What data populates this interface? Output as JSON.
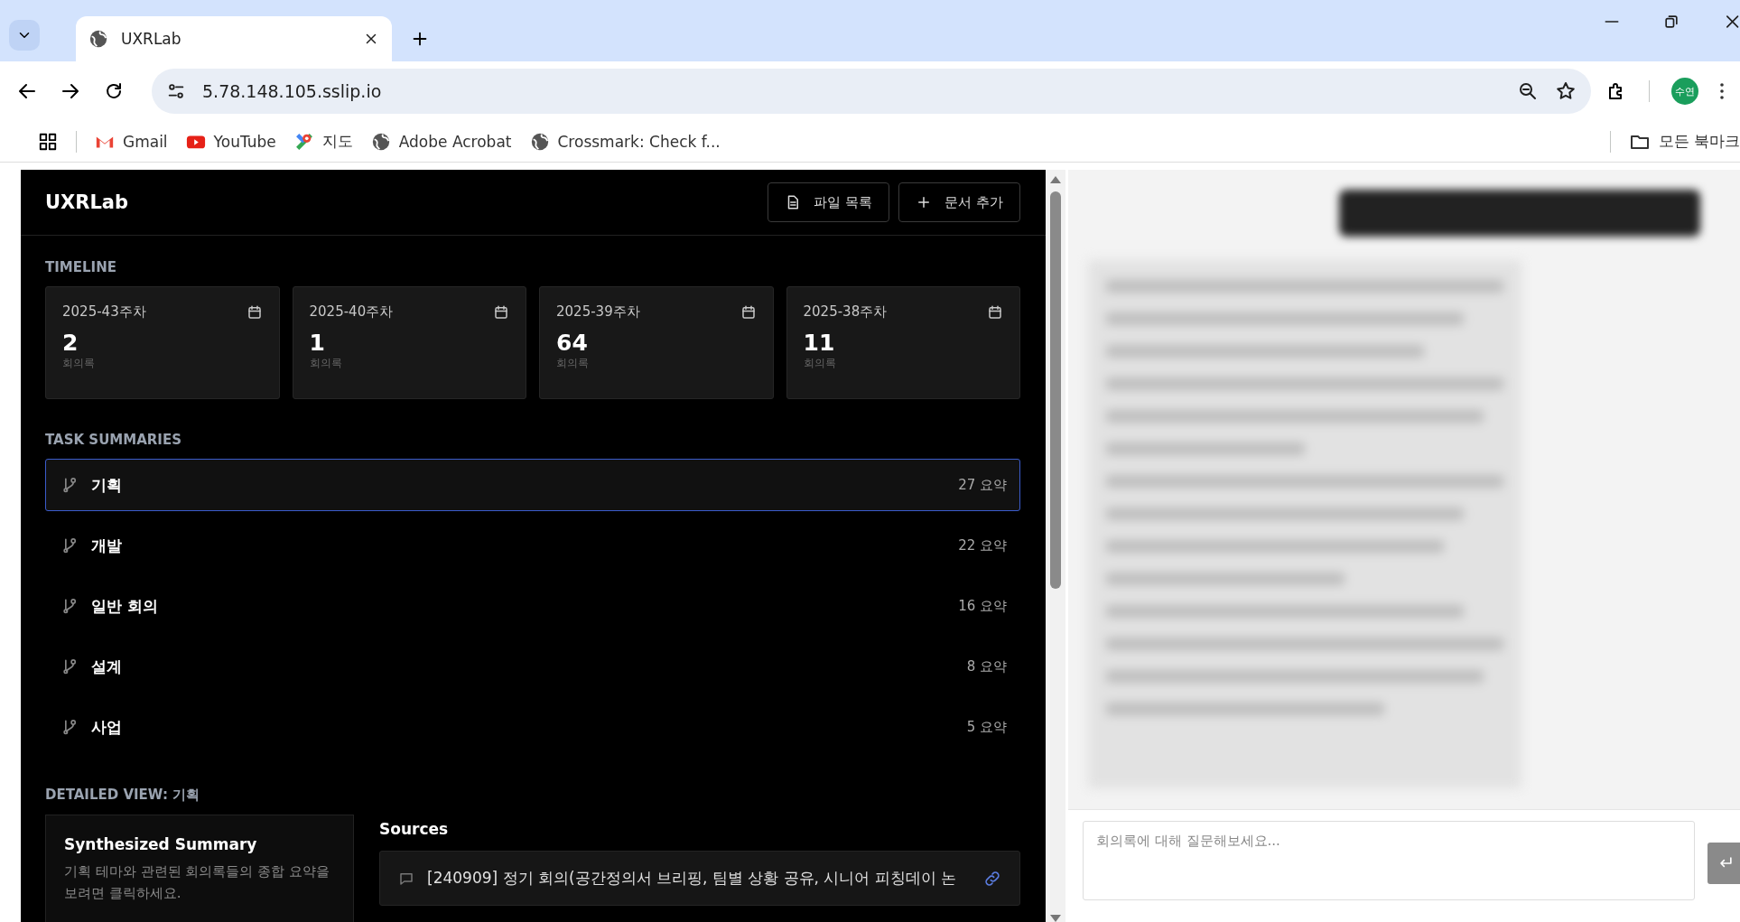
{
  "browser": {
    "tab_title": "UXRLab",
    "url": "5.78.148.105.sslip.io",
    "avatar_text": "수연",
    "bookmarks": [
      {
        "kind": "gmail",
        "label": "Gmail"
      },
      {
        "kind": "youtube",
        "label": "YouTube"
      },
      {
        "kind": "maps",
        "label": "지도"
      },
      {
        "kind": "globe",
        "label": "Adobe Acrobat"
      },
      {
        "kind": "globe",
        "label": "Crossmark: Check f..."
      }
    ],
    "all_bookmarks": "모든 북마크"
  },
  "app": {
    "title": "UXRLab",
    "buttons": [
      {
        "kind": "file",
        "label": "파일 목록"
      },
      {
        "kind": "add",
        "label": "문서 추가"
      }
    ],
    "timeline": {
      "label": "TIMELINE",
      "cards": [
        {
          "week": "2025-43주차",
          "count": "2",
          "unit": "회의록"
        },
        {
          "week": "2025-40주차",
          "count": "1",
          "unit": "회의록"
        },
        {
          "week": "2025-39주차",
          "count": "64",
          "unit": "회의록"
        },
        {
          "week": "2025-38주차",
          "count": "11",
          "unit": "회의록"
        }
      ]
    },
    "tasks": {
      "label": "TASK SUMMARIES",
      "items": [
        {
          "name": "기획",
          "count": "27 요약",
          "selected": true
        },
        {
          "name": "개발",
          "count": "22 요약",
          "selected": false
        },
        {
          "name": "일반 회의",
          "count": "16 요약",
          "selected": false
        },
        {
          "name": "설계",
          "count": "8 요약",
          "selected": false
        },
        {
          "name": "사업",
          "count": "5 요약",
          "selected": false
        }
      ]
    },
    "detail": {
      "label": "DETAILED VIEW: 기획",
      "summary": {
        "title": "Synthesized Summary",
        "text": "기획 테마와 관련된 회의록들의 종합 요약을 보려면 클릭하세요."
      },
      "sources": {
        "label": "Sources",
        "items": [
          {
            "text": "[240909] 정기 회의(공간정의서 브리핑, 팀별 상황 공유, 시니어 피칭데이 논"
          }
        ]
      }
    }
  },
  "chat": {
    "placeholder": "회의록에 대해 질문해보세요..."
  }
}
